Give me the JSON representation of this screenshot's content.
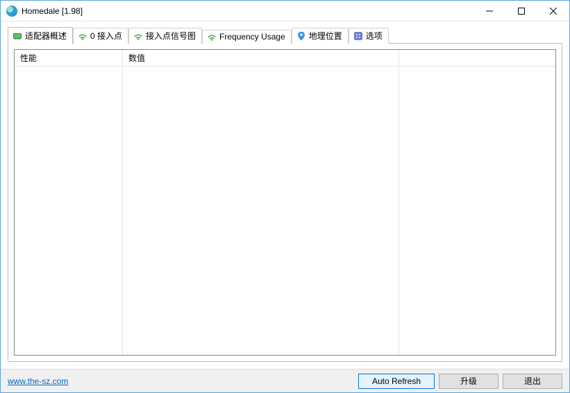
{
  "window": {
    "title": "Homedale [1.98]"
  },
  "tabs": [
    {
      "label": "适配器概述"
    },
    {
      "label": "0 接入点"
    },
    {
      "label": "接入点信号图"
    },
    {
      "label": "Frequency Usage"
    },
    {
      "label": "地理位置"
    },
    {
      "label": "选项"
    }
  ],
  "columns": {
    "col1": "性能",
    "col2": "数值",
    "col3": ""
  },
  "footer": {
    "link": "www.the-sz.com",
    "auto_refresh": "Auto Refresh",
    "upgrade": "升级",
    "exit": "退出"
  }
}
